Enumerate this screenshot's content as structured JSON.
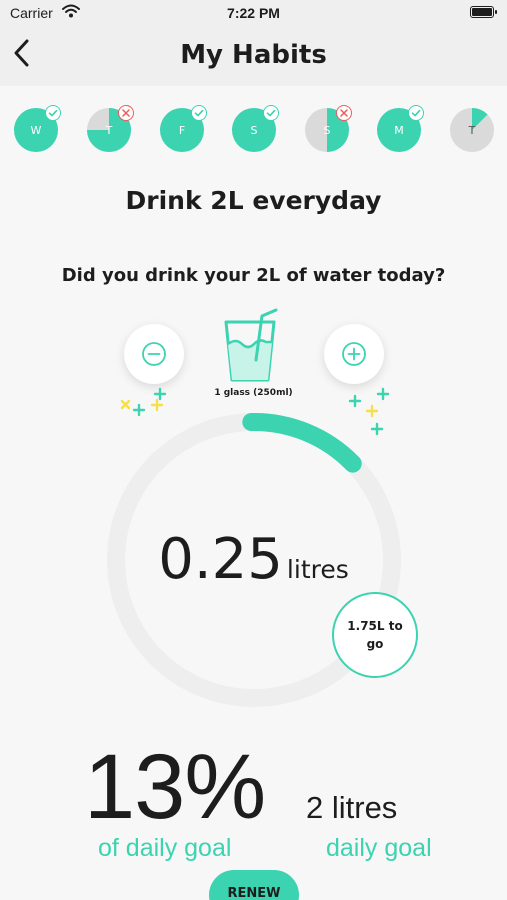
{
  "status_bar": {
    "carrier": "Carrier",
    "time": "7:22 PM"
  },
  "nav": {
    "back_icon": "chevron-left-icon",
    "title": "My Habits"
  },
  "days": [
    {
      "letter": "W",
      "status": "done",
      "fill": 1.0
    },
    {
      "letter": "T",
      "status": "missed",
      "fill": 0.75
    },
    {
      "letter": "F",
      "status": "done",
      "fill": 1.0
    },
    {
      "letter": "S",
      "status": "done",
      "fill": 1.0
    },
    {
      "letter": "S",
      "status": "missed",
      "fill": 0.5
    },
    {
      "letter": "M",
      "status": "done",
      "fill": 1.0
    },
    {
      "letter": "T",
      "status": "today",
      "fill": 0.125
    }
  ],
  "habit": {
    "title": "Drink 2L everyday",
    "question": "Did you drink your 2L of water today?",
    "glass_label": "1 glass (250ml)",
    "minus_icon": "minus-circle-icon",
    "plus_icon": "plus-circle-icon",
    "glass_icon": "glass-with-straw-icon"
  },
  "progress": {
    "amount": "0.25",
    "unit": "litres",
    "remaining": "1.75L to go",
    "fraction": 0.125,
    "percent": "13%",
    "percent_caption": "of daily goal",
    "goal": "2 litres",
    "goal_caption": "daily goal"
  },
  "renew_label": "RENEW",
  "colors": {
    "accent": "#3bd3b0",
    "empty": "#dadada",
    "miss": "#f05a5a",
    "spark_yellow": "#f4e04a"
  }
}
